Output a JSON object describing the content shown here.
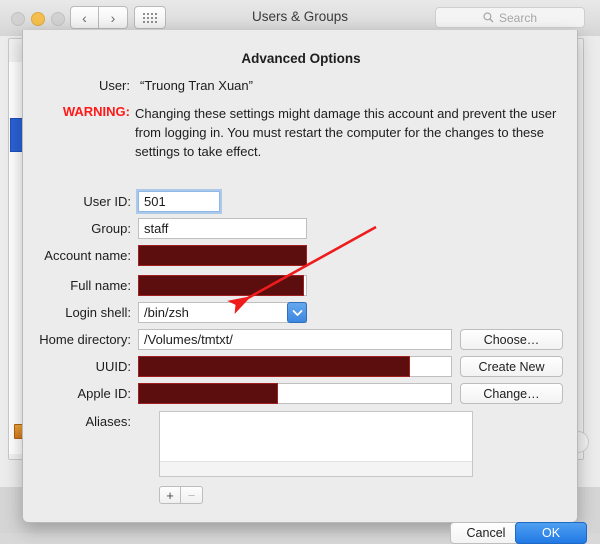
{
  "window": {
    "title": "Users & Groups",
    "traffic_lights": [
      "close",
      "minimize",
      "zoom"
    ],
    "nav_back_glyph": "‹",
    "nav_forward_glyph": "›",
    "grid_icon": "show-all-grid-icon",
    "search": {
      "placeholder": "Search",
      "icon": "search-icon"
    }
  },
  "sheet": {
    "title": "Advanced Options",
    "user_label": "User:",
    "user_value": "“Truong Tran Xuan”",
    "warning_label": "WARNING:",
    "warning_text": "Changing these settings might damage this account and prevent the user from logging in. You must restart the computer for the changes to these settings to take effect.",
    "warning_color": "#ff1a1a",
    "fields": [
      {
        "label": "User ID:",
        "value": "501",
        "redacted": false,
        "focused": true
      },
      {
        "label": "Group:",
        "value": "staff",
        "redacted": false,
        "focused": false
      },
      {
        "label": "Account name:",
        "value": "",
        "redacted": true,
        "focused": false
      },
      {
        "label": "Full name:",
        "value": "",
        "redacted": true,
        "focused": false
      },
      {
        "label": "Login shell:",
        "value": "/bin/zsh",
        "redacted": false,
        "focused": false
      },
      {
        "label": "Home directory:",
        "value": "/Volumes/tmtxt/",
        "redacted": false,
        "focused": false
      },
      {
        "label": "UUID:",
        "value": "",
        "redacted": true,
        "focused": false
      },
      {
        "label": "Apple ID:",
        "value": "",
        "redacted": true,
        "focused": false
      },
      {
        "label": "Aliases:",
        "value": "",
        "redacted": false,
        "focused": false
      }
    ],
    "side_buttons": [
      {
        "label": "Choose…"
      },
      {
        "label": "Create New"
      },
      {
        "label": "Change…"
      }
    ],
    "alias_add_label": "+",
    "alias_remove_label": "−",
    "cancel_label": "Cancel",
    "ok_label": "OK",
    "combo_chevron": "chevron-down-icon",
    "accent_blue": "#2179e4",
    "redaction_color": "#5c0d0d"
  },
  "annotation": {
    "arrow_color": "#ee1c1c",
    "points_at": "Home directory:"
  }
}
